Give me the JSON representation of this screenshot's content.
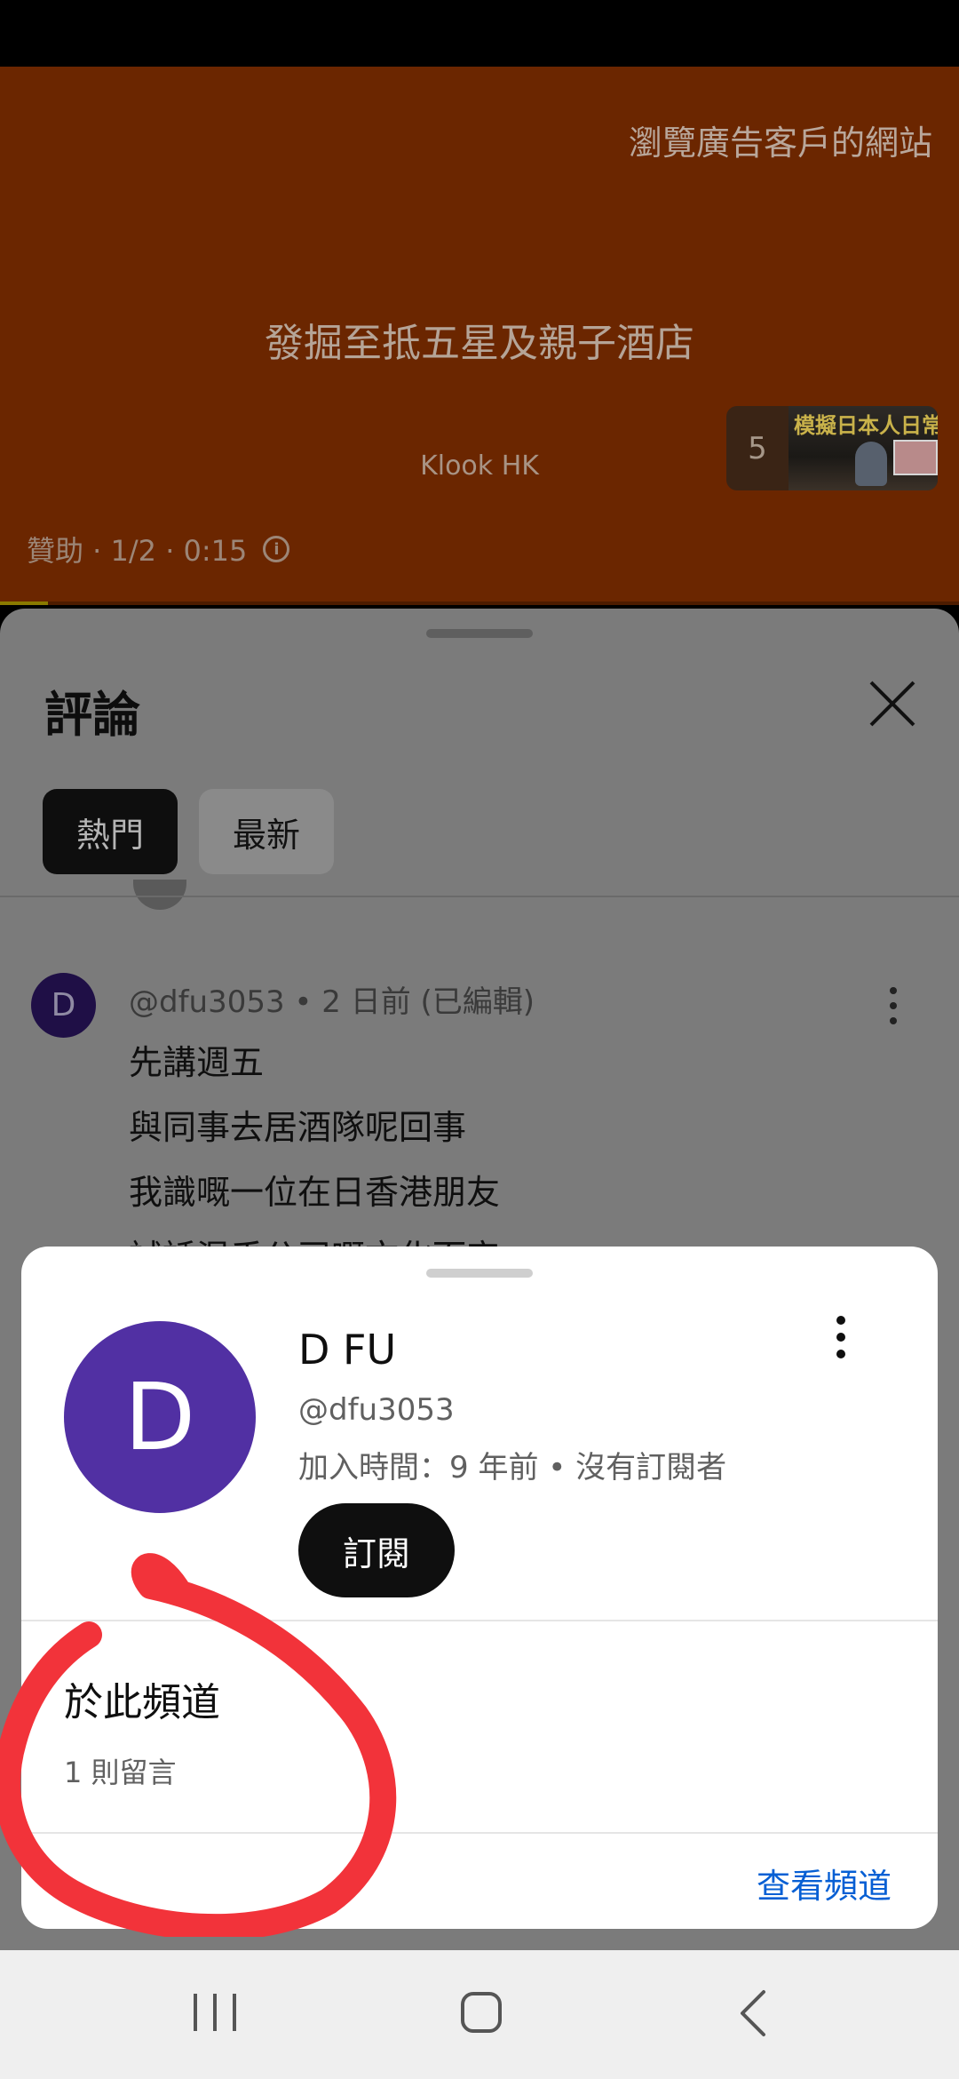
{
  "ad": {
    "visit_advertiser": "瀏覽廣告客戶的網站",
    "headline": "發掘至抵五星及親子酒店",
    "brand": "Klook HK",
    "meta": "贊助 · 1/2 · 0:15",
    "next_up_count": "5",
    "next_up_thumb_title": "模擬日本人日常",
    "progress": 0.05
  },
  "comments": {
    "title": "評論",
    "tabs": [
      {
        "label": "熱門",
        "selected": true
      },
      {
        "label": "最新",
        "selected": false
      }
    ],
    "comment": {
      "avatar_letter": "D",
      "meta": "@dfu3053 • 2 日前 (已編輯)",
      "lines": [
        "先講週五",
        "與同事去居酒隊呢回事",
        "我識嘅一位在日香港朋友",
        "試話混乎公司嘅文化而定"
      ]
    }
  },
  "channel_card": {
    "avatar_letter": "D",
    "name": "D FU",
    "handle": "@dfu3053",
    "stats": "加入時間：9 年前 • 沒有訂閱者",
    "subscribe_label": "訂閱",
    "section_heading": "於此頻道",
    "section_count": "1 則留言",
    "view_channel_label": "查看頻道"
  },
  "colors": {
    "ad_background": "#6b2600",
    "avatar_purple": "#5130a3",
    "link_blue": "#065fd4",
    "annotation_red": "#f2333a"
  },
  "nav": {
    "recents": "recents-icon",
    "home": "home-icon",
    "back": "back-icon"
  }
}
